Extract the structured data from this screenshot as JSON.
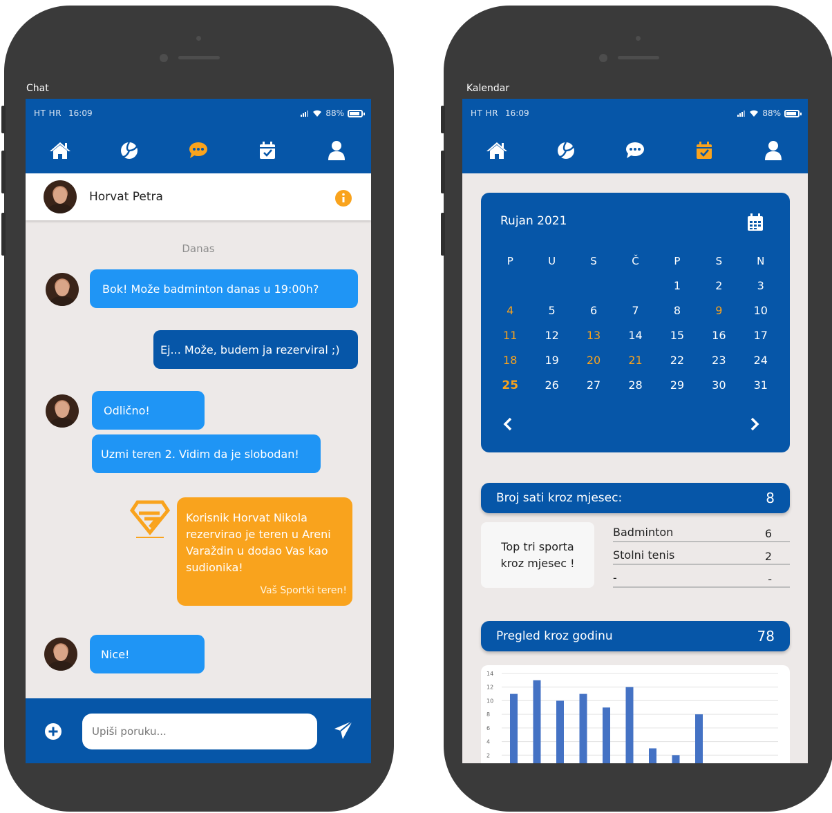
{
  "chat_screen": {
    "label": "Chat",
    "status": {
      "carrier": "HT HR",
      "time": "16:09",
      "battery": "88%"
    },
    "nav_active": "chat",
    "header": {
      "name": "Horvat Petra"
    },
    "date_divider": "Danas",
    "messages": [
      {
        "text": "Bok! Može badminton danas u 19:00h?",
        "from": "them"
      },
      {
        "text": "Ej... Može, budem ja rezerviral ;)",
        "from": "me"
      },
      {
        "text": "Odlično!",
        "from": "them"
      },
      {
        "text": "Uzmi teren 2. Vidim da je slobodan!",
        "from": "them"
      },
      {
        "text": "Nice!",
        "from": "them"
      }
    ],
    "system_message": {
      "text": "Korisnik Horvat Nikola rezervirao je teren u Areni Varaždin u dodao Vas kao sudionika!",
      "signature": "Vaš Sportki teren!"
    },
    "input": {
      "placeholder": "Upiši poruku..."
    }
  },
  "calendar_screen": {
    "label": "Kalendar",
    "status": {
      "carrier": "HT HR",
      "time": "16:09",
      "battery": "88%"
    },
    "nav_active": "calendar",
    "calendar": {
      "title": "Rujan 2021",
      "weekdays": [
        "P",
        "U",
        "S",
        "Č",
        "P",
        "S",
        "N"
      ],
      "leading_blanks": 4,
      "days": 31,
      "highlighted_days": [
        4,
        9,
        11,
        13,
        18,
        20,
        21
      ],
      "today": 25
    },
    "monthly_hours": {
      "label": "Broj sati kroz mjesec:",
      "value": "8"
    },
    "top_sports": {
      "label": "Top tri sporta kroz mjesec !",
      "rows": [
        {
          "name": "Badminton",
          "count": "6"
        },
        {
          "name": "Stolni tenis",
          "count": "2"
        },
        {
          "name": "-",
          "count": "-"
        }
      ]
    },
    "year_overview": {
      "label": "Pregled kroz godinu",
      "value": "78"
    }
  },
  "chart_data": {
    "type": "bar",
    "values": [
      11,
      13,
      10,
      11,
      9,
      12,
      3,
      2,
      8
    ],
    "ylim": [
      0,
      14
    ],
    "yticks": [
      "14",
      "12",
      "10",
      "8",
      "6",
      "4",
      "2"
    ],
    "color": "#4472c4"
  },
  "colors": {
    "primary": "#0656a8",
    "accent": "#f9a31d",
    "bubble_in": "#1f95f5",
    "phone": "#3a3a3a"
  }
}
